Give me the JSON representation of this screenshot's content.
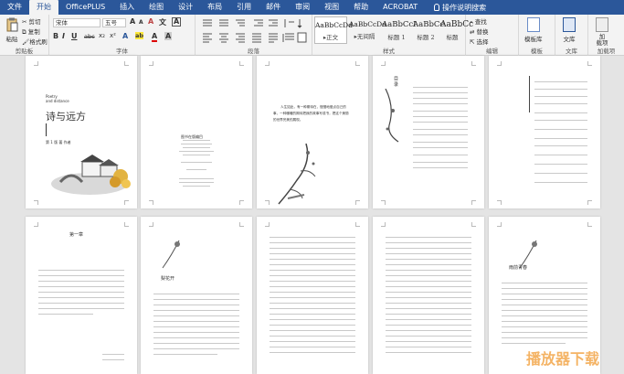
{
  "tabs": [
    "文件",
    "开始",
    "OfficePLUS",
    "插入",
    "绘图",
    "设计",
    "布局",
    "引用",
    "邮件",
    "审阅",
    "视图",
    "帮助",
    "ACROBAT"
  ],
  "tellme": "操作说明搜索",
  "clipboard": {
    "paste": "粘贴",
    "cut": "剪切",
    "copy": "复制",
    "painter": "格式刷",
    "group": "剪贴板"
  },
  "font": {
    "family": "宋体",
    "size": "五号",
    "bold": "B",
    "italic": "I",
    "underline": "U",
    "strike": "abc",
    "sub": "x₂",
    "sup": "x²",
    "grow": "A",
    "shrink": "A",
    "clear": "A",
    "phonetic": "文",
    "border": "A",
    "highlight": "ab",
    "color": "A",
    "group": "字体"
  },
  "paragraph": {
    "group": "段落"
  },
  "styles": {
    "group": "样式",
    "items": [
      {
        "sample": "AaBbCcDd",
        "name": "▸正文"
      },
      {
        "sample": "AaBbCcDd",
        "name": "▸无间隔"
      },
      {
        "sample": "AaBbCcI",
        "name": "标题 1"
      },
      {
        "sample": "AaBbCc",
        "name": "标题 2"
      },
      {
        "sample": "AaBbCc",
        "name": "标题"
      }
    ]
  },
  "editing": {
    "find": "查找",
    "replace": "替换",
    "select": "选择",
    "group": "编辑"
  },
  "template": {
    "label": "模板库",
    "group": "模板"
  },
  "doc": {
    "label": "文库",
    "group": "文库"
  },
  "addin": {
    "label": "加\n载项",
    "group": "加载项"
  },
  "pages": {
    "cover_en1": "Poetry",
    "cover_en2": "and distance",
    "cover_title": "诗与远方",
    "cover_sub": "第 1 版  著 作者",
    "p2_title": "图书在版编目",
    "p3_line1": "人生如此，有一种期待在，慢慢地做点自己的",
    "p3_line2": "事，一种暖暖的期待把我的故事写成书，把这个美丽",
    "p3_line3": "的世界完美的展现。",
    "p4_title": "目 录",
    "p6_title": "第一章",
    "p7_title": "梨花开",
    "p10_title": "雨前青春"
  },
  "watermark": "播放器下载"
}
